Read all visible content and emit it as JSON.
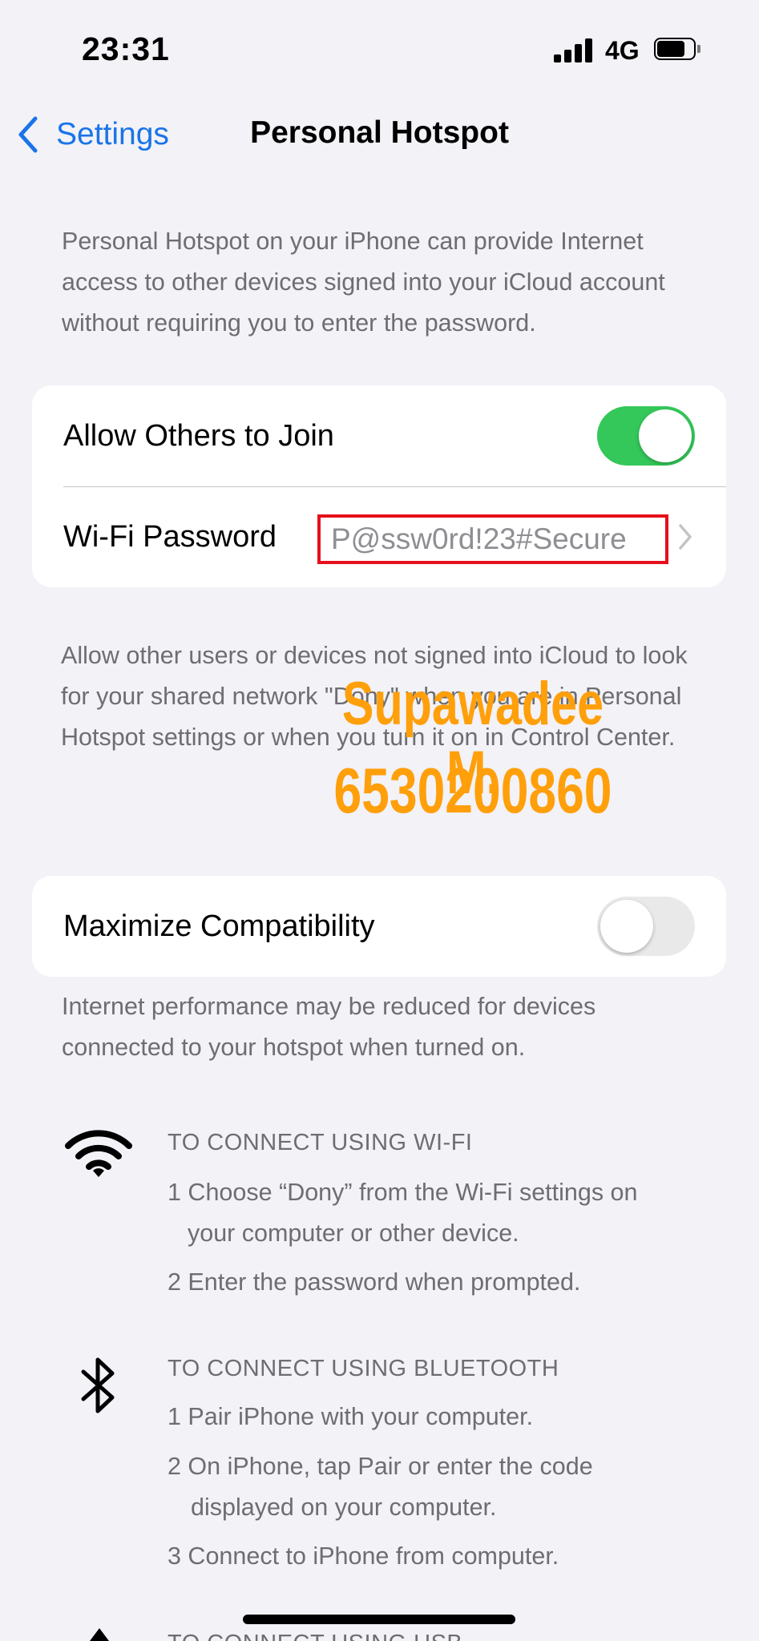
{
  "status": {
    "time": "23:31",
    "network": "4G"
  },
  "nav": {
    "back_label": "Settings",
    "title": "Personal Hotspot"
  },
  "intro": "Personal Hotspot on your iPhone can provide Internet access to other devices signed into your iCloud account without requiring you to enter the password.",
  "group1": {
    "allow_label": "Allow Others to Join",
    "allow_on": true,
    "password_label": "Wi-Fi Password",
    "password_value": "P@ssw0rd!23#Secure"
  },
  "allow_desc": "Allow other users or devices not signed into iCloud to look for your shared network \"Dony\" when you are in Personal Hotspot settings or when you turn it on in Control Center.",
  "watermark": {
    "name": "Supawadee M.",
    "id": "6530200860",
    "color": "#ff9f0a"
  },
  "group2": {
    "compat_label": "Maximize Compatibility",
    "compat_on": false
  },
  "compat_desc": "Internet performance may be reduced for devices connected to your hotspot when turned on.",
  "wifi": {
    "heading": "TO CONNECT USING WI-FI",
    "step1a": "1 Choose “Dony” from the Wi-Fi settings on",
    "step1b": "your computer or other device.",
    "step2": "2 Enter the password when prompted."
  },
  "bluetooth": {
    "heading": "TO CONNECT USING BLUETOOTH",
    "step1": "1 Pair iPhone with your computer.",
    "step2a": "2 On iPhone, tap Pair or enter the code",
    "step2b": "displayed on your computer.",
    "step3": "3 Connect to iPhone from computer."
  },
  "usb": {
    "heading": "TO CONNECT USING USB"
  },
  "colors": {
    "accent": "#1a74e8",
    "toggle_on": "#34c759",
    "highlight_box": "#e5101b",
    "background": "#f2f2f7"
  }
}
